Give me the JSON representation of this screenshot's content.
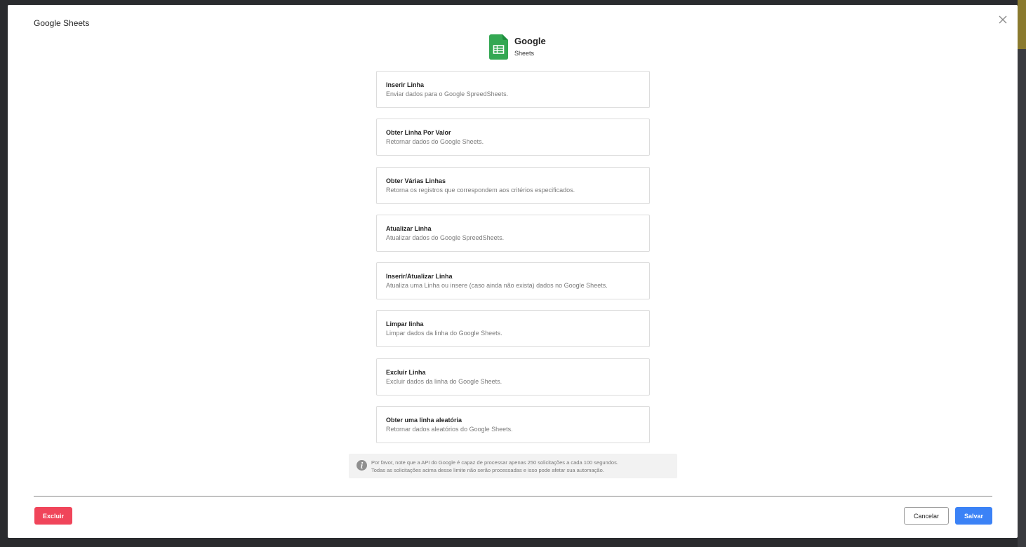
{
  "modal": {
    "title": "Google Sheets"
  },
  "brand": {
    "name": "Google",
    "product": "Sheets",
    "icon": "google-sheets-icon",
    "color": "#34a853"
  },
  "actions": [
    {
      "title": "Inserir Linha",
      "description": "Enviar dados para o Google SpreedSheets."
    },
    {
      "title": "Obter Linha Por Valor",
      "description": "Retornar dados do Google Sheets."
    },
    {
      "title": "Obter Várias Linhas",
      "description": "Retorna os registros que correspondem aos critérios especificados."
    },
    {
      "title": "Atualizar Linha",
      "description": "Atualizar dados do Google SpreedSheets."
    },
    {
      "title": "Inserir/Atualizar Linha",
      "description": "Atualiza uma Linha ou insere (caso ainda não exista) dados no Google Sheets."
    },
    {
      "title": "Limpar linha",
      "description": "Limpar dados da linha do Google Sheets."
    },
    {
      "title": "Excluir Linha",
      "description": "Excluir dados da linha do Google Sheets."
    },
    {
      "title": "Obter uma linha aleatória",
      "description": "Retornar dados aleatórios do Google Sheets."
    }
  ],
  "notice": {
    "icon": "info-icon",
    "line1": "Por favor, note que a API do Google é capaz de processar apenas 250 solicitações a cada 100 segundos.",
    "line2": "Todas as solicitações acima desse limite não serão processadas e isso pode afetar sua automação."
  },
  "footer": {
    "delete_label": "Excluir",
    "cancel_label": "Cancelar",
    "save_label": "Salvar",
    "delete_color": "#f0455a",
    "save_color": "#3b82f6"
  }
}
